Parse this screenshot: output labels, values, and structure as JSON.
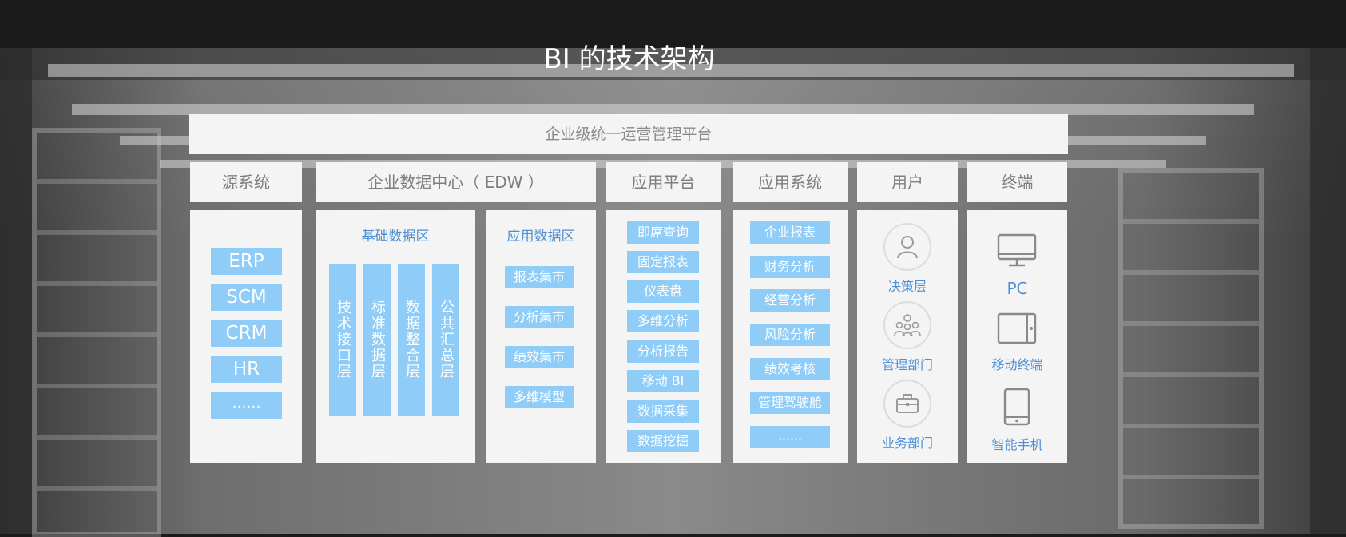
{
  "title": "BI 的技术架构",
  "banner": "企业级统一运营管理平台",
  "headers": {
    "source": "源系统",
    "edw": "企业数据中心（ EDW ）",
    "platform": "应用平台",
    "apps": "应用系统",
    "users": "用户",
    "terminals": "终端"
  },
  "source_items": [
    "ERP",
    "SCM",
    "CRM",
    "HR",
    "……"
  ],
  "base_zone": {
    "title": "基础数据区",
    "layers": [
      "技术接口层",
      "标准数据层",
      "数据整合层",
      "公共汇总层"
    ]
  },
  "app_zone": {
    "title": "应用数据区",
    "items": [
      "报表集市",
      "分析集市",
      "绩效集市",
      "多维模型"
    ]
  },
  "platform_items": [
    "即席查询",
    "固定报表",
    "仪表盘",
    "多维分析",
    "分析报告",
    "移动 BI",
    "数据采集",
    "数据挖掘"
  ],
  "app_items": [
    "企业报表",
    "财务分析",
    "经营分析",
    "风险分析",
    "绩效考核",
    "管理驾驶舱",
    "……"
  ],
  "users": [
    {
      "label": "决策层",
      "icon": "person-icon"
    },
    {
      "label": "管理部门",
      "icon": "group-icon"
    },
    {
      "label": "业务部门",
      "icon": "briefcase-icon"
    }
  ],
  "terminals": [
    {
      "label": "PC",
      "icon": "monitor-icon"
    },
    {
      "label": "移动终端",
      "icon": "tablet-icon"
    },
    {
      "label": "智能手机",
      "icon": "smartphone-icon"
    }
  ],
  "colors": {
    "chip": "#8fcdf8",
    "accent_text": "#4a8fd6",
    "card": "#f4f4f4",
    "header_text": "#7e7e7e"
  }
}
